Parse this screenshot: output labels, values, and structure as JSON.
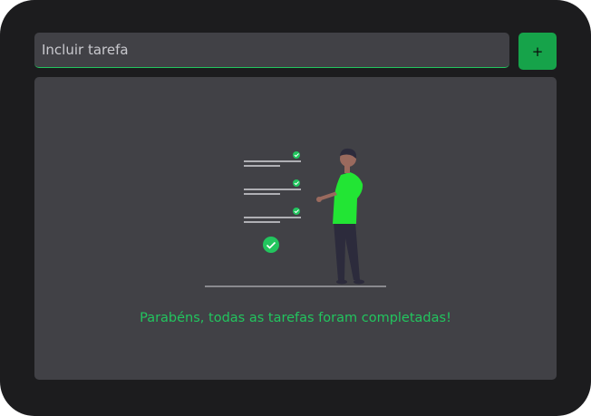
{
  "task_form": {
    "input_placeholder": "Incluir tarefa",
    "input_value": "",
    "add_button_label": "+"
  },
  "task_list": {
    "empty_message": "Parabéns, todas as tarefas foram completadas!",
    "illustration_icon": "completed-tasks-illustration"
  },
  "colors": {
    "background": "#1c1c1e",
    "surface": "#414146",
    "accent": "#16a34a",
    "accent_text": "#22c55e"
  }
}
